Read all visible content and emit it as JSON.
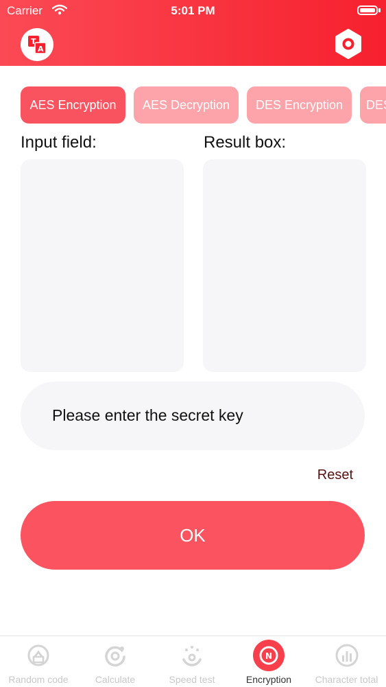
{
  "status_bar": {
    "carrier": "Carrier",
    "time": "5:01 PM"
  },
  "tabs": [
    {
      "label": "AES Encryption",
      "active": true
    },
    {
      "label": "AES Decryption",
      "active": false
    },
    {
      "label": "DES Encryption",
      "active": false
    },
    {
      "label": "DES",
      "active": false
    }
  ],
  "input_label": "Input field:",
  "result_label": "Result box:",
  "key_placeholder": "Please enter the secret key",
  "reset_label": "Reset",
  "ok_label": "OK",
  "bottom_tabs": [
    {
      "label": "Random code",
      "icon": "random-code-icon",
      "active": false
    },
    {
      "label": "Calculate",
      "icon": "calculate-icon",
      "active": false
    },
    {
      "label": "Speed test",
      "icon": "speed-test-icon",
      "active": false
    },
    {
      "label": "Encryption",
      "icon": "encryption-icon",
      "active": true
    },
    {
      "label": "Character total",
      "icon": "character-total-icon",
      "active": false
    }
  ],
  "colors": {
    "accent": "#f9535f",
    "tab_inactive": "#fca4aa",
    "header": "#f7202e"
  }
}
